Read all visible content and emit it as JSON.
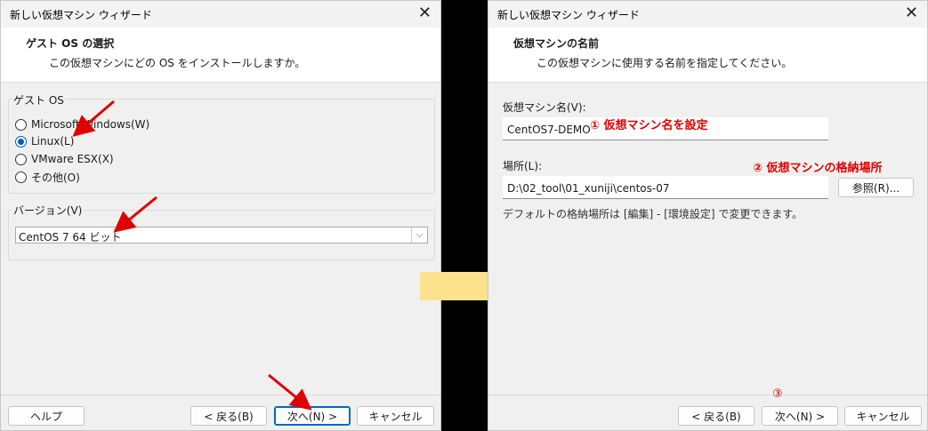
{
  "left": {
    "window_title": "新しい仮想マシン ウィザード",
    "header_title": "ゲスト OS の選択",
    "header_subtitle": "この仮想マシンにどの OS をインストールしますか。",
    "guest_os_label": "ゲスト OS",
    "radios": [
      {
        "label": "Microsoft Windows(W)",
        "selected": false
      },
      {
        "label": "Linux(L)",
        "selected": true
      },
      {
        "label": "VMware ESX(X)",
        "selected": false
      },
      {
        "label": "その他(O)",
        "selected": false
      }
    ],
    "version_label": "バージョン(V)",
    "version_value": "CentOS 7 64 ビット",
    "buttons": {
      "help": "ヘルプ",
      "back": "< 戻る(B)",
      "next": "次へ(N) >",
      "cancel": "キャンセル"
    }
  },
  "right": {
    "window_title": "新しい仮想マシン ウィザード",
    "header_title": "仮想マシンの名前",
    "header_subtitle": "この仮想マシンに使用する名前を指定してください。",
    "name_label": "仮想マシン名(V):",
    "name_value": "CentOS7-DEMO",
    "location_label": "場所(L):",
    "location_value": "D:\\02_tool\\01_xuniji\\centos-07",
    "browse_button": "参照(R)...",
    "note": "デフォルトの格納場所は [編集] - [環境設定] で変更できます。",
    "buttons": {
      "back": "< 戻る(B)",
      "next": "次へ(N) >",
      "cancel": "キャンセル"
    }
  },
  "annotations": {
    "step1": "① 仮想マシン名を設定",
    "step2": "② 仮想マシンの格納場所",
    "step3": "③"
  },
  "colors": {
    "annotation_red": "#e00000",
    "arrow_yellow": "#fde18c",
    "accent_blue": "#0067c0"
  },
  "icons": {
    "close": "close-icon",
    "dropdown": "chevron-down-icon",
    "transition_arrow": "right-arrow-icon"
  }
}
